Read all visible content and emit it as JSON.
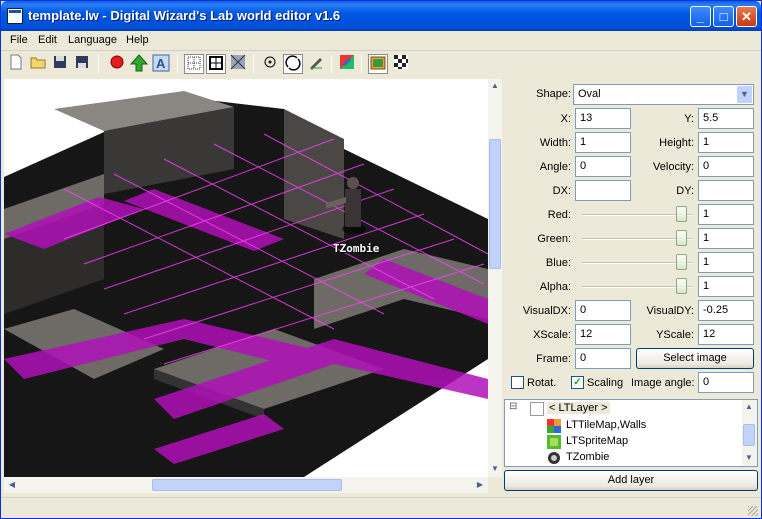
{
  "window": {
    "title": "template.lw - Digital Wizard's Lab world editor v1.6",
    "min_icon": "minimize-icon",
    "max_icon": "maximize-icon",
    "close_icon": "close-icon",
    "min_glyph": "_",
    "max_glyph": "□",
    "close_glyph": "✕"
  },
  "menu": [
    "File",
    "Edit",
    "Language",
    "Help"
  ],
  "toolbar": {
    "icons": [
      "new-file-icon",
      "open-folder-icon",
      "save-icon",
      "save-as-icon",
      "record-icon",
      "up-arrow-icon",
      "text-a-icon",
      "grid-dotted-icon",
      "grid-frame-icon",
      "tile-pattern-icon",
      "point-icon",
      "rotate-icon",
      "draw-icon",
      "color-layer-icon",
      "image-layer-icon",
      "checker-icon"
    ]
  },
  "canvas": {
    "sprite_label": "TZombie",
    "colors": {
      "floor": "#151515",
      "wall": "#5a5753",
      "accent": "#b010b8"
    }
  },
  "props": {
    "shape_label": "Shape:",
    "shape_value": "Oval",
    "x_label": "X:",
    "x_value": "13",
    "y_label": "Y:",
    "y_value": "5.5",
    "width_label": "Width:",
    "width_value": "1",
    "height_label": "Height:",
    "height_value": "1",
    "angle_label": "Angle:",
    "angle_value": "0",
    "velocity_label": "Velocity:",
    "velocity_value": "0",
    "dx_label": "DX:",
    "dx_value": "",
    "dy_label": "DY:",
    "dy_value": "",
    "red_label": "Red:",
    "red_value": "1",
    "red_level": 1,
    "green_label": "Green:",
    "green_value": "1",
    "green_level": 1,
    "blue_label": "Blue:",
    "blue_value": "1",
    "blue_level": 1,
    "alpha_label": "Alpha:",
    "alpha_value": "1",
    "alpha_level": 1,
    "visualdx_label": "VisualDX:",
    "visualdx_value": "0",
    "visualdy_label": "VisualDY:",
    "visualdy_value": "-0.25",
    "xscale_label": "XScale:",
    "xscale_value": "12",
    "yscale_label": "YScale:",
    "yscale_value": "12",
    "frame_label": "Frame:",
    "frame_value": "0",
    "select_image": "Select image",
    "rotat_label": "Rotat.",
    "rotat_checked": false,
    "scaling_label": "Scaling",
    "scaling_checked": true,
    "image_angle_label": "Image angle:",
    "image_angle_value": "0"
  },
  "tree": {
    "root": "< LTLayer >",
    "items": [
      "LTTileMap,Walls",
      "LTSpriteMap",
      "TZombie"
    ],
    "expand_glyph": "⊟"
  },
  "add_layer": "Add layer"
}
